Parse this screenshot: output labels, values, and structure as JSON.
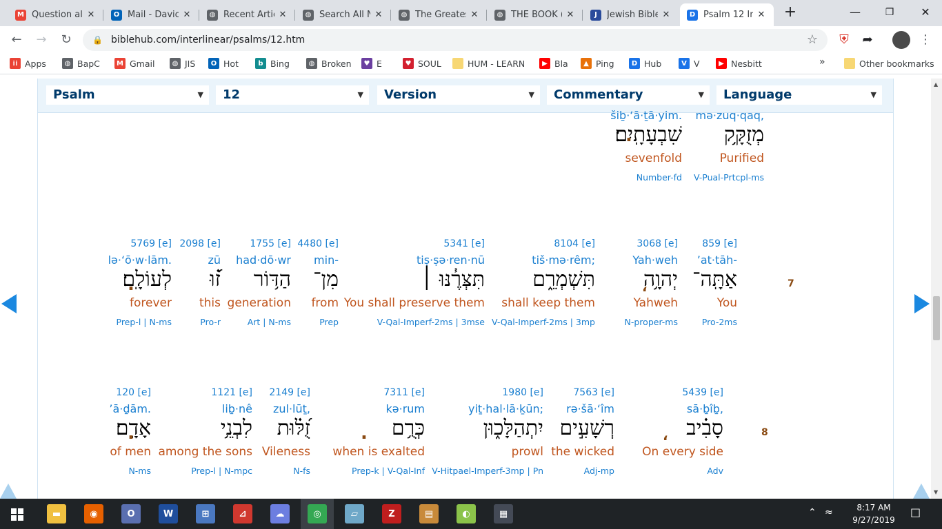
{
  "tabs": [
    {
      "title": "Question al",
      "favicon": "gmail-icon",
      "color": "#ea4335",
      "glyph": "M"
    },
    {
      "title": "Mail - Davic",
      "favicon": "outlook-icon",
      "color": "#0364b8",
      "glyph": "O"
    },
    {
      "title": "Recent Artic",
      "favicon": "globe-icon",
      "color": "#5f6368",
      "glyph": "◍"
    },
    {
      "title": "Search All N",
      "favicon": "globe-icon",
      "color": "#5f6368",
      "glyph": "◍"
    },
    {
      "title": "The Greates",
      "favicon": "globe-icon",
      "color": "#5f6368",
      "glyph": "◍"
    },
    {
      "title": "THE BOOK (",
      "favicon": "globe-icon",
      "color": "#5f6368",
      "glyph": "◍"
    },
    {
      "title": "Jewish Bible",
      "favicon": "jewish-bible-icon",
      "color": "#2a4b9b",
      "glyph": "J"
    },
    {
      "title": "Psalm 12 In",
      "favicon": "biblehub-icon",
      "color": "#1a73e8",
      "glyph": "D"
    }
  ],
  "url": "biblehub.com/interlinear/psalms/12.htm",
  "bookmarks": [
    {
      "label": "Apps",
      "icon": "apps-grid-icon",
      "color": "#ea4335",
      "glyph": "⁞⁞"
    },
    {
      "label": "BapC",
      "icon": "globe-icon",
      "color": "#5f6368",
      "glyph": "◍"
    },
    {
      "label": "Gmail",
      "icon": "gmail-icon",
      "color": "#ea4335",
      "glyph": "M"
    },
    {
      "label": "JIS",
      "icon": "globe-icon",
      "color": "#5f6368",
      "glyph": "◍"
    },
    {
      "label": "Hot",
      "icon": "outlook-icon",
      "color": "#0364b8",
      "glyph": "O"
    },
    {
      "label": "Bing",
      "icon": "bing-icon",
      "color": "#138d90",
      "glyph": "b"
    },
    {
      "label": "Broken",
      "icon": "globe-icon",
      "color": "#5f6368",
      "glyph": "◍"
    },
    {
      "label": "E",
      "icon": "heart-gem-icon",
      "color": "#6b3fa0",
      "glyph": "♥"
    },
    {
      "label": "SOUL",
      "icon": "heart-icon",
      "color": "#d3202f",
      "glyph": "♥"
    },
    {
      "label": "HUM - LEARN",
      "icon": "folder-icon",
      "color": "#f7d774",
      "glyph": ""
    },
    {
      "label": "Bla",
      "icon": "youtube-icon",
      "color": "#ff0000",
      "glyph": "▶"
    },
    {
      "label": "Ping",
      "icon": "flame-icon",
      "color": "#e8710a",
      "glyph": "▲"
    },
    {
      "label": "Hub",
      "icon": "biblehub-icon",
      "color": "#1a73e8",
      "glyph": "D"
    },
    {
      "label": "V",
      "icon": "vimeo-icon",
      "color": "#1a73e8",
      "glyph": "V"
    },
    {
      "label": "Nesbitt",
      "icon": "youtube-icon",
      "color": "#ff0000",
      "glyph": "▶"
    }
  ],
  "bookmarks_more": "»",
  "other_bookmarks": "Other bookmarks",
  "selectors": [
    "Psalm",
    "12",
    "Version",
    "Commentary",
    "Language"
  ],
  "row_top": {
    "words": [
      {
        "translit": "šiḇ·‘ā·ṯā·yim.",
        "heb": "שִׁבְעָתָֽיִם׃",
        "eng": "sevenfold",
        "parse": "Number-fd"
      },
      {
        "translit": "mə·zuq·qaq,",
        "heb": "מְזֻקָּ֥ק",
        "eng": "Purified",
        "parse": "V-Pual-Prtcpl-ms"
      }
    ]
  },
  "verse7": {
    "num": "7",
    "words": [
      {
        "strong": "5769 [e]",
        "translit": "lə·‘ō·w·lām.",
        "heb": "לְעוֹלָֽם׃",
        "eng": "forever",
        "parse": "Prep-l | N-ms"
      },
      {
        "strong": "2098 [e]",
        "translit": "zū",
        "heb": "ז֝֗וּ",
        "eng": "this",
        "parse": "Pro-r"
      },
      {
        "strong": "1755 [e]",
        "translit": "had·dō·wr",
        "heb": "הַדּ֥וֹר",
        "eng": "generation",
        "parse": "Art | N-ms"
      },
      {
        "strong": "4480 [e]",
        "translit": "min-",
        "heb": "מִן־",
        "eng": "from",
        "parse": "Prep"
      },
      {
        "strong": "5341 [e]",
        "translit": "tiṣ·ṣə·ren·nū",
        "heb": "תִּצְּרֶ֓נּוּ ׀",
        "eng": "You shall preserve them",
        "parse": "V-Qal-Imperf-2ms | 3mse"
      },
      {
        "strong": "8104 [e]",
        "translit": "tiš·mə·rêm;",
        "heb": "תִּשְׁמְרֵ֑ם",
        "eng": "shall keep them",
        "parse": "V-Qal-Imperf-2ms | 3mp"
      },
      {
        "strong": "3068 [e]",
        "translit": "Yah·weh",
        "heb": "יְהוָ֥ה",
        "eng": "Yahweh",
        "parse": "N-proper-ms"
      },
      {
        "strong": "859 [e]",
        "translit": "’at·tāh-",
        "heb": "אַתָּֽה־",
        "eng": "You",
        "parse": "Pro-2ms"
      }
    ]
  },
  "verse8": {
    "num": "8",
    "words": [
      {
        "strong": "120 [e]",
        "translit": "’ā·ḏām.",
        "heb": "אָדָֽם׃",
        "eng": "of men",
        "parse": "N-ms"
      },
      {
        "strong": "1121 [e]",
        "translit": "liḇ·nê",
        "heb": "לִבְנֵ֥י",
        "eng": "among the sons",
        "parse": "Prep-l | N-mpc"
      },
      {
        "strong": "2149 [e]",
        "translit": "zul·lūṯ,",
        "heb": "זֻ֝לּ֗וּת",
        "eng": "Vileness",
        "parse": "N-fs"
      },
      {
        "strong": "7311 [e]",
        "translit": "kə·rum",
        "heb": "כְּרֻ֥ם",
        "eng": "when is exalted",
        "parse": "Prep-k | V-Qal-Inf"
      },
      {
        "strong": "1980 [e]",
        "translit": "yiṯ·hal·lā·ḵūn;",
        "heb": "יִתְהַלָּכ֑וּן",
        "eng": "prowl",
        "parse": "V-Hitpael-Imperf-3mp | Pn"
      },
      {
        "strong": "7563 [e]",
        "translit": "rə·šā·‘îm",
        "heb": "רְשָׁעִ֣ים",
        "eng": "the wicked",
        "parse": "Adj-mp"
      },
      {
        "strong": "5439 [e]",
        "translit": "sā·ḇîḇ,",
        "heb": "סָבִ֗יב",
        "eng": "On every side",
        "parse": "Adv"
      }
    ]
  },
  "punct": {
    "period": ".",
    "comma": "،"
  },
  "taskbar": {
    "apps": [
      {
        "name": "file-explorer-icon",
        "color": "#f0c040",
        "glyph": "▬"
      },
      {
        "name": "firefox-icon",
        "color": "#e66000",
        "glyph": "◉"
      },
      {
        "name": "outlook-app-icon",
        "color": "#5a6fb0",
        "glyph": "O"
      },
      {
        "name": "word-icon",
        "color": "#1f4e9c",
        "glyph": "W"
      },
      {
        "name": "network-app-icon",
        "color": "#4a78c0",
        "glyph": "⊞"
      },
      {
        "name": "pdf-icon",
        "color": "#d0382f",
        "glyph": "⊿"
      },
      {
        "name": "cloud-drive-icon",
        "color": "#6c7ee0",
        "glyph": "☁"
      },
      {
        "name": "chrome-icon",
        "color": "#34a853",
        "glyph": "◎"
      },
      {
        "name": "notepad-icon",
        "color": "#6fa8c8",
        "glyph": "▱"
      },
      {
        "name": "filezilla-icon",
        "color": "#bf1e1e",
        "glyph": "Z"
      },
      {
        "name": "bible-app-icon",
        "color": "#c88a3a",
        "glyph": "▤"
      },
      {
        "name": "android-icon",
        "color": "#8bc34a",
        "glyph": "◐"
      },
      {
        "name": "video-app-icon",
        "color": "#444a56",
        "glyph": "▦"
      }
    ],
    "time": "8:17 AM",
    "date": "9/27/2019"
  }
}
